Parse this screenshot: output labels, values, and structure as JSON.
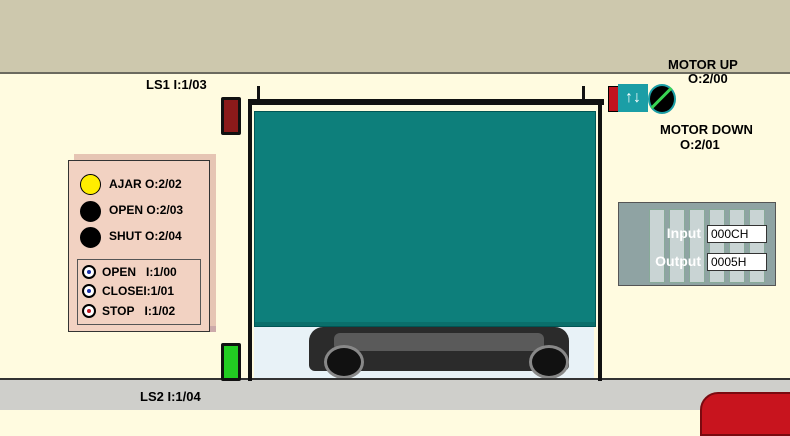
{
  "labels": {
    "ls1": "LS1  I:1/03",
    "ls2": "LS2  I:1/04",
    "motor_up": "MOTOR UP",
    "motor_up_addr": "O:2/00",
    "motor_down": "MOTOR DOWN",
    "motor_down_addr": "O:2/01"
  },
  "panel": {
    "indicators": [
      {
        "label": "AJAR",
        "addr": "O:2/02",
        "color": "#ffee00"
      },
      {
        "label": "OPEN",
        "addr": "O:2/03",
        "color": "#000000"
      },
      {
        "label": "SHUT",
        "addr": "O:2/04",
        "color": "#000000"
      }
    ],
    "buttons": [
      {
        "label": "OPEN",
        "addr": "I:1/00",
        "color": "#1a2fa8"
      },
      {
        "label": "CLOSE",
        "addr": "I:1/01",
        "color": "#1a2fa8"
      },
      {
        "label": "STOP",
        "addr": "I:1/02",
        "color": "#c0141e"
      }
    ]
  },
  "plc": {
    "input_label": "Input",
    "input_value": "000CH",
    "output_label": "Output",
    "output_value": "0005H"
  },
  "colors": {
    "door": "#0d7f7b",
    "ls1": "#8b1a1a",
    "ls2": "#22cc22"
  }
}
